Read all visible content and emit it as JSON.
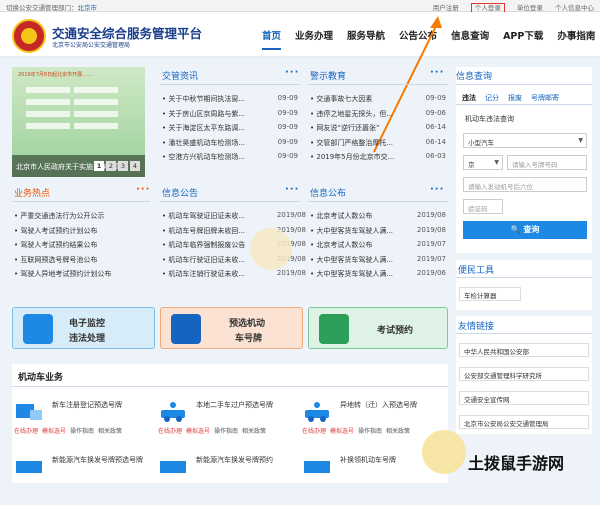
{
  "topbar": {
    "left_text": "切换公安交通管理部门：",
    "city": "北京市",
    "links": [
      "用户注册",
      "个人登录",
      "单位登录",
      "个人信息中心"
    ]
  },
  "header": {
    "title": "交通安全综合服务管理平台",
    "subtitle": "北京市公安局公安交通管理局",
    "nav": [
      "首页",
      "业务办理",
      "服务导航",
      "公告公布",
      "信息查询",
      "APP下载",
      "办事指南"
    ]
  },
  "banner": {
    "title": "2019年7月8日起北京市开展……",
    "caption": "北京市人民政府关于实施工作日高...",
    "pages": [
      "1",
      "2",
      "3",
      "4"
    ]
  },
  "traffic_news": {
    "title": "交管资讯",
    "more": "···",
    "items": [
      {
        "t": "关于中秋节期间执法窗...",
        "d": "09-09"
      },
      {
        "t": "关于房山区京周路与紫...",
        "d": "09-09"
      },
      {
        "t": "关于海淀区太平东路调...",
        "d": "09-09"
      },
      {
        "t": "潘壮昊盛机动车检测场...",
        "d": "09-09"
      },
      {
        "t": "空港方兴机动车检测场...",
        "d": "09-09"
      }
    ]
  },
  "warning": {
    "title": "警示教育",
    "more": "···",
    "items": [
      {
        "t": "交通事故七大因素",
        "d": "09-09"
      },
      {
        "t": "违停之地星无探头，但...",
        "d": "09-06"
      },
      {
        "t": "网友说“逆行还嚣张”",
        "d": "06-14"
      },
      {
        "t": "交管部门严格整治摩托...",
        "d": "06-14"
      },
      {
        "t": "2019年5月份北京市交...",
        "d": "06-03"
      }
    ]
  },
  "hotspots": {
    "title": "业务热点",
    "more": "···",
    "items": [
      "严重交通违法行为公开公示",
      "驾驶人考试预约计划公布",
      "驾驶人考试预约结果公布",
      "互联网预选号牌号池公布",
      "驾驶人异地考试预约计划公布"
    ]
  },
  "notices": {
    "title": "信息公告",
    "more": "···",
    "items": [
      {
        "t": "机动车驾驶证旧证未收...",
        "d": "2019/08"
      },
      {
        "t": "机动车号牌旧牌未收回...",
        "d": "2019/08"
      },
      {
        "t": "机动车临界强制报废公告",
        "d": "2019/08"
      },
      {
        "t": "机动车行驶证旧证未收...",
        "d": "2019/08"
      },
      {
        "t": "机动车注销行驶证未收...",
        "d": "2019/08"
      }
    ]
  },
  "info_release": {
    "title": "信息公布",
    "more": "···",
    "items": [
      {
        "t": "北京考试人数公布",
        "d": "2019/08"
      },
      {
        "t": "大中型客货车驾驶人满...",
        "d": "2019/08"
      },
      {
        "t": "北京考试人数公布",
        "d": "2019/07"
      },
      {
        "t": "大中型客货车驾驶人满...",
        "d": "2019/07"
      },
      {
        "t": "大中型客货车驾驶人满...",
        "d": "2019/06"
      }
    ]
  },
  "query": {
    "title": "信息查询",
    "tabs": [
      "违法",
      "记分",
      "报废",
      "号牌邮寄"
    ],
    "label": "机动车违法查询",
    "vehicle_type": "小型汽车",
    "region": "京",
    "plate_placeholder": "请输入号牌号码",
    "engine_placeholder": "请输入发动机号后六位",
    "captcha_placeholder": "验证码",
    "button": "查询"
  },
  "tools": {
    "title": "便民工具",
    "items": [
      "车检计算器"
    ]
  },
  "links": {
    "title": "友情链接",
    "items": [
      "中华人民共和国公安部",
      "公安部交通管理科学研究所",
      "交通安全宣传网",
      "北京市公安局公安交通管理局"
    ]
  },
  "features": [
    {
      "label1": "电子监控",
      "label2": "违法处理"
    },
    {
      "label1": "预选机动",
      "label2": "车号牌"
    },
    {
      "label1": "考试预约",
      "label2": ""
    }
  ],
  "vehicle_business": {
    "title": "机动车业务",
    "services": [
      {
        "name": "新车注册登记预选号牌",
        "links": [
          "在线办理",
          "模拟选号",
          "操作指南",
          "相关政策"
        ]
      },
      {
        "name": "本地二手车过户预选号牌",
        "links": [
          "在线办理",
          "模拟选号",
          "操作指南",
          "相关政策"
        ]
      },
      {
        "name": "异地转（迁）入预选号牌",
        "links": [
          "在线办理",
          "模拟选号",
          "操作指南",
          "相关政策"
        ]
      },
      {
        "name": "新能源汽车换发号牌预选号牌",
        "links": []
      },
      {
        "name": "新能源汽车换发号牌预约",
        "links": []
      },
      {
        "name": "补换领机动车号牌",
        "links": []
      }
    ]
  },
  "watermark": {
    "text": "土拨鼠手游网"
  },
  "colors": {
    "primary": "#1565c0",
    "accent": "#e65100",
    "alert": "#e53935"
  }
}
